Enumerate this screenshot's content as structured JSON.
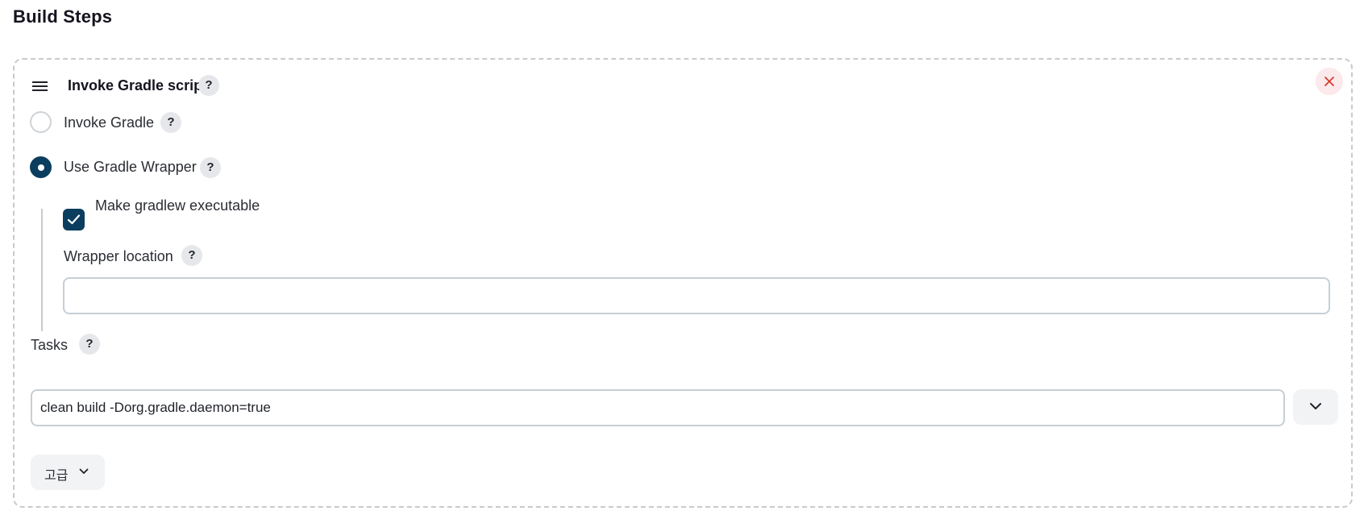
{
  "section": {
    "title": "Build Steps"
  },
  "step": {
    "title": "Invoke Gradle script",
    "help": "?",
    "close_icon": "close-icon",
    "drag_icon": "hamburger-icon",
    "accent_close": "#d92d20"
  },
  "options": {
    "invoke_gradle": {
      "label": "Invoke Gradle",
      "selected": false,
      "help": "?"
    },
    "use_wrapper": {
      "label": "Use Gradle Wrapper",
      "selected": true,
      "help": "?"
    }
  },
  "wrapper": {
    "make_executable": {
      "label": "Make gradlew executable",
      "checked": true
    },
    "location": {
      "label": "Wrapper location",
      "value": "",
      "help": "?"
    }
  },
  "tasks": {
    "label": "Tasks",
    "help": "?",
    "value": "clean build -Dorg.gradle.daemon=true",
    "expand_icon": "chevron-down-icon"
  },
  "advanced": {
    "label": "고급",
    "icon": "chevron-down-icon"
  },
  "colors": {
    "primary": "#0b3d5e",
    "help_bg": "#e6e7ea",
    "close_bg": "#fbe9ec",
    "close_fg": "#d92d20",
    "border_dashed": "#c8cacd"
  }
}
